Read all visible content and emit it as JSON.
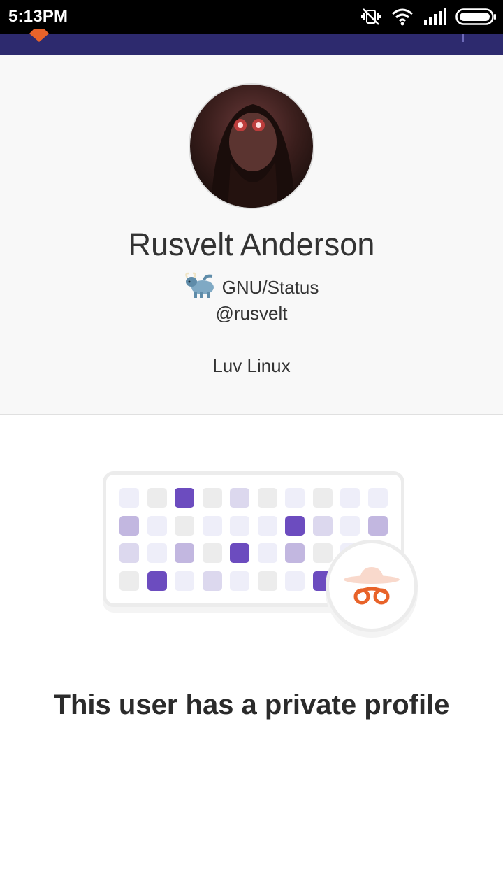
{
  "status_bar": {
    "time": "5:13PM",
    "icons": [
      "vibrate-off-icon",
      "wifi-icon",
      "signal-icon",
      "battery-icon"
    ]
  },
  "profile": {
    "name": "Rusvelt Anderson",
    "status_emoji": "gnu-icon",
    "status_text": "GNU/Status",
    "handle": "@rusvelt",
    "bio": "Luv Linux"
  },
  "private": {
    "message": "This user has a private profile",
    "illustration_icon": "spy-icon"
  },
  "colors": {
    "app_bar": "#2d2a6e",
    "accent_purple": "#6c4cbf",
    "spy_orange": "#e8632a"
  }
}
